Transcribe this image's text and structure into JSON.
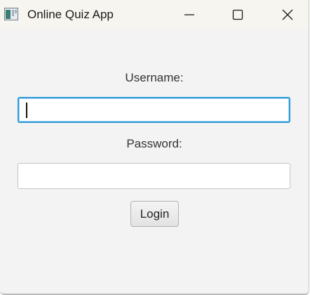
{
  "window": {
    "title": "Online Quiz App",
    "app_icon": "java-app-icon",
    "controls": {
      "minimize_icon": "minimize-icon",
      "maximize_icon": "maximize-icon",
      "close_icon": "close-icon"
    }
  },
  "form": {
    "username_label": "Username:",
    "username_value": "",
    "password_label": "Password:",
    "password_value": "",
    "login_label": "Login"
  },
  "colors": {
    "window_background": "#f3f3f3",
    "titlebar_background": "#f7f5ef",
    "focus_accent": "#2e9ad6"
  }
}
